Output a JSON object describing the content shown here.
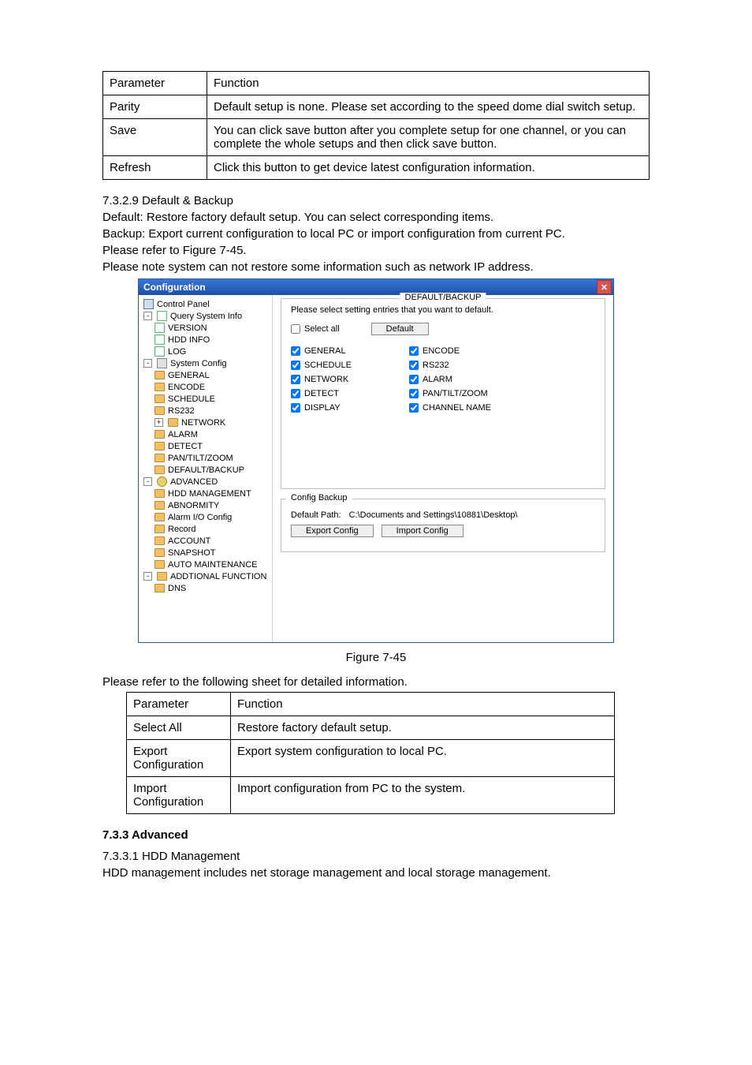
{
  "table1": {
    "header": {
      "c0": "Parameter",
      "c1": "Function"
    },
    "rows": [
      {
        "c0": "Parity",
        "c1": "Default setup is none. Please set according to the speed dome dial switch setup."
      },
      {
        "c0": "Save",
        "c1": "You can click save button after you complete setup for one channel, or you can complete the whole setups and then click save button."
      },
      {
        "c0": "Refresh",
        "c1": "Click this button to get device latest configuration information."
      }
    ]
  },
  "heading_7_3_2_9": "7.3.2.9  Default & Backup",
  "para1": "Default: Restore factory default setup. You can select corresponding items.",
  "para2": "Backup: Export current configuration to local PC or import configuration from current PC.",
  "para3": "Please refer to Figure 7-45.",
  "para4": "Please note system can not restore some information such as network IP address.",
  "shot": {
    "title": "Configuration",
    "tree": {
      "control_panel": "Control Panel",
      "query": "Query System Info",
      "version": "VERSION",
      "hdd_info": "HDD INFO",
      "log": "LOG",
      "system_config": "System Config",
      "general": "GENERAL",
      "encode": "ENCODE",
      "schedule": "SCHEDULE",
      "rs232": "RS232",
      "network": "NETWORK",
      "alarm": "ALARM",
      "detect": "DETECT",
      "ptz": "PAN/TILT/ZOOM",
      "default_backup": "DEFAULT/BACKUP",
      "advanced": "ADVANCED",
      "hdd_mgmt": "HDD MANAGEMENT",
      "abnormity": "ABNORMITY",
      "alarm_io": "Alarm I/O Config",
      "record": "Record",
      "account": "ACCOUNT",
      "snapshot": "SNAPSHOT",
      "auto_maint": "AUTO MAINTENANCE",
      "addtional": "ADDTIONAL FUNCTION",
      "dns": "DNS"
    },
    "main": {
      "legend_top": "DEFAULT/BACKUP",
      "instruction": "Please select setting entries that you want to default.",
      "select_all": "Select all",
      "default_btn": "Default",
      "checks": {
        "general": "GENERAL",
        "encode": "ENCODE",
        "schedule": "SCHEDULE",
        "rs232": "RS232",
        "network": "NETWORK",
        "alarm": "ALARM",
        "detect": "DETECT",
        "ptz": "PAN/TILT/ZOOM",
        "display": "DISPLAY",
        "channel_name": "CHANNEL NAME"
      },
      "legend_bottom": "Config Backup",
      "default_path_label": "Default Path:",
      "default_path_value": "C:\\Documents and Settings\\10881\\Desktop\\",
      "export_btn": "Export Config",
      "import_btn": "Import Config"
    }
  },
  "figure_caption": "Figure 7-45",
  "para5": "Please refer to the following sheet for detailed information.",
  "table2": {
    "header": {
      "c0": "Parameter",
      "c1": "Function"
    },
    "rows": [
      {
        "c0": "Select All",
        "c1": "Restore factory default setup."
      },
      {
        "c0": "Export Configuration",
        "c1": "Export system configuration to local PC."
      },
      {
        "c0": "Import Configuration",
        "c1": "Import configuration from PC to the system."
      }
    ]
  },
  "heading_7_3_3": "7.3.3  Advanced",
  "heading_7_3_3_1": "7.3.3.1  HDD Management",
  "para6": "HDD management includes net storage management and local storage management."
}
